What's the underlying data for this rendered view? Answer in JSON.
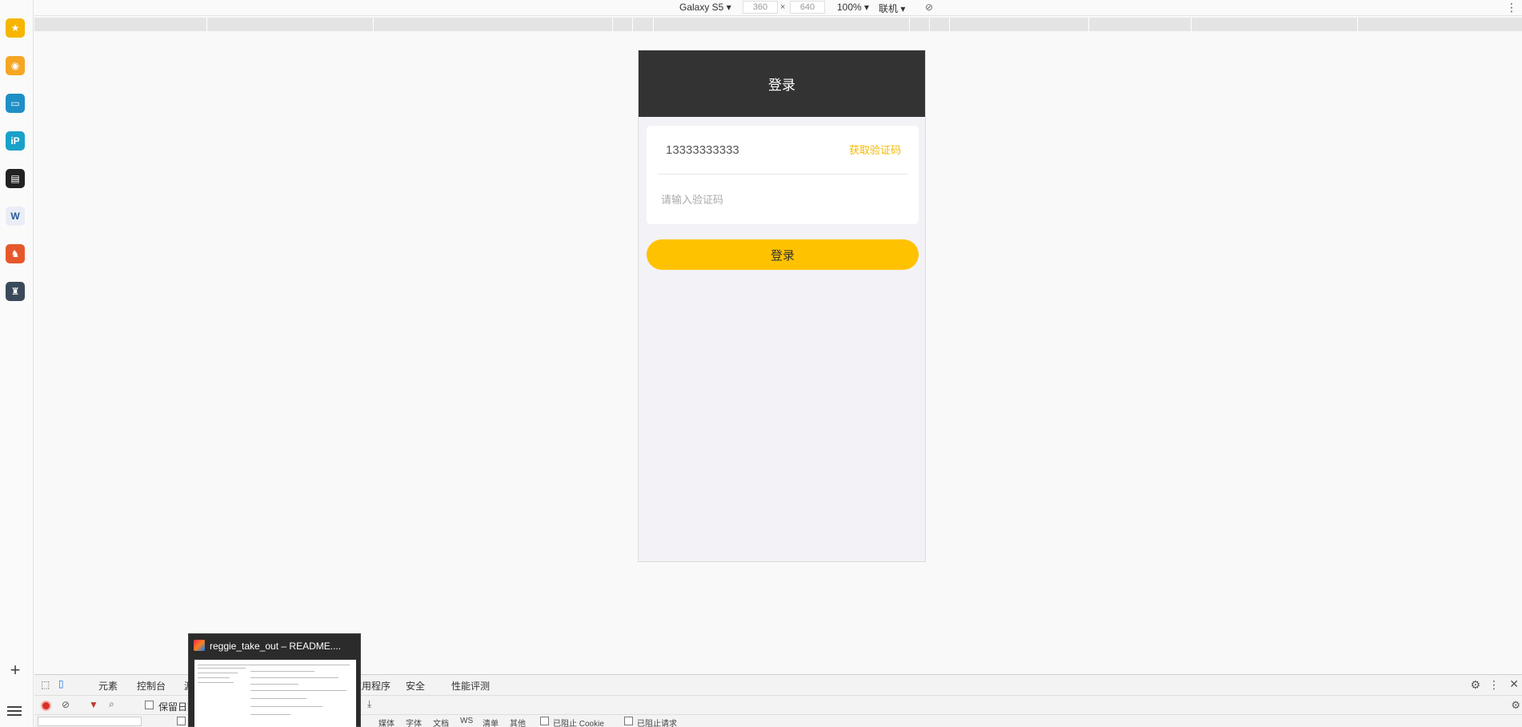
{
  "sidebar": {
    "apps": [
      {
        "icon": "favorites-star-icon",
        "color": "#f7b500"
      },
      {
        "icon": "weibo-icon",
        "color": "#f5a623"
      },
      {
        "icon": "screen-app-icon",
        "color": "#1e8fc6"
      },
      {
        "icon": "ip-app-icon",
        "color": "#1aa1c9"
      },
      {
        "icon": "reader-app-icon",
        "color": "#222222"
      },
      {
        "icon": "word-doc-icon",
        "color": "#e9eef6"
      },
      {
        "icon": "game-app-icon-1",
        "color": "#e6582b"
      },
      {
        "icon": "game-app-icon-2",
        "color": "#3b4a5a"
      }
    ]
  },
  "device_toolbar": {
    "device": "Galaxy S5",
    "width": "360",
    "times": "×",
    "height": "640",
    "zoom": "100%",
    "network": "联机"
  },
  "phone": {
    "header_title": "登录",
    "phone_number": "13333333333",
    "get_code_label": "获取验证码",
    "code_placeholder": "请输入验证码",
    "login_button": "登录",
    "accent_color": "#ffc200",
    "header_color": "#333333"
  },
  "devtools": {
    "tabs": [
      "元素",
      "控制台",
      "源",
      "应用程序",
      "安全",
      "性能评测"
    ],
    "preserve_log": "保留日志",
    "filters": [
      "媒体",
      "字体",
      "文档",
      "WS",
      "清单",
      "其他"
    ],
    "blocked_cookies": "已阻止 Cookie",
    "blocked_requests": "已阻止请求"
  },
  "taskbar_preview": {
    "title": "reggie_take_out – README...."
  }
}
